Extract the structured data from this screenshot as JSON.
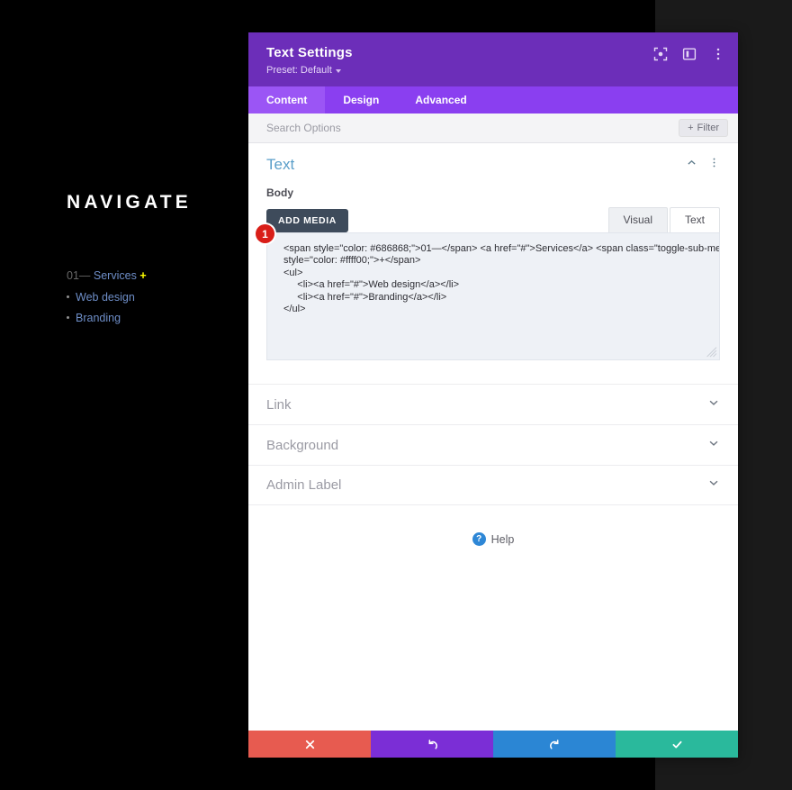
{
  "site": {
    "heading": "NAVIGATE",
    "menu": {
      "number": "01—",
      "link": "Services",
      "toggle": "+",
      "sub_items": [
        "Web design",
        "Branding"
      ]
    },
    "colors": {
      "background": "#000000",
      "number": "#686868",
      "link": "#6e8ec8",
      "toggle": "#ffff00"
    }
  },
  "modal": {
    "title": "Text Settings",
    "preset": "Preset: Default",
    "header_icons": [
      "expand-icon",
      "layout-icon",
      "kebab-menu-icon"
    ],
    "tabs": [
      {
        "label": "Content",
        "active": true
      },
      {
        "label": "Design",
        "active": false
      },
      {
        "label": "Advanced",
        "active": false
      }
    ],
    "search": {
      "placeholder": "Search Options",
      "value": ""
    },
    "filter_label": "Filter",
    "section": {
      "title": "Text",
      "field_label": "Body",
      "add_media_label": "ADD MEDIA",
      "editor_tabs": [
        {
          "label": "Visual",
          "active": false
        },
        {
          "label": "Text",
          "active": true
        }
      ],
      "error_badge": "1",
      "code": "<span style=\"color: #686868;\">01—</span> <a href=\"#\">Services</a> <span class=\"toggle-sub-menu\"\nstyle=\"color: #ffff00;\">+</span>\n<ul>\n     <li><a href=\"#\">Web design</a></li>\n     <li><a href=\"#\">Branding</a></li>\n</ul>"
    },
    "accordions": [
      {
        "label": "Link"
      },
      {
        "label": "Background"
      },
      {
        "label": "Admin Label"
      }
    ],
    "help_label": "Help",
    "footer_buttons": [
      {
        "name": "cancel",
        "icon": "close-icon",
        "color": "#e75b50"
      },
      {
        "name": "undo",
        "icon": "undo-icon",
        "color": "#7b2ed6"
      },
      {
        "name": "redo",
        "icon": "redo-icon",
        "color": "#2b86d4"
      },
      {
        "name": "save",
        "icon": "check-icon",
        "color": "#2ab99c"
      }
    ],
    "colors": {
      "header": "#6c2eb9",
      "tabbar": "#8a3ff0",
      "tab_active": "#9b55f5",
      "section_title": "#5a9ec9",
      "badge": "#d91e18"
    }
  }
}
